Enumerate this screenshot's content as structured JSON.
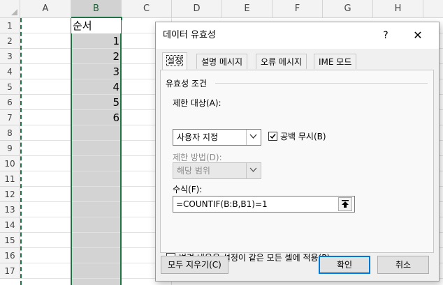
{
  "sheet": {
    "columns": [
      "A",
      "B",
      "C",
      "D",
      "E",
      "F",
      "G",
      "H"
    ],
    "rows": [
      "1",
      "2",
      "3",
      "4",
      "5",
      "6",
      "7",
      "8",
      "9",
      "10",
      "11",
      "12",
      "13",
      "14",
      "15",
      "16",
      "17"
    ],
    "b1": "순서",
    "b_values": [
      "1",
      "2",
      "3",
      "4",
      "5",
      "6"
    ],
    "selected_column": "B",
    "accent_color": "#217346"
  },
  "dialog": {
    "title": "데이터 유효성",
    "help": "?",
    "close": "✕",
    "tabs": [
      "설정",
      "설명 메시지",
      "오류 메시지",
      "IME 모드"
    ],
    "group_title": "유효성 조건",
    "allow_label": "제한 대상(A):",
    "allow_value": "사용자 지정",
    "ignore_blank_label": "공백 무시(B)",
    "ignore_blank_checked": true,
    "data_label": "제한 방법(D):",
    "data_value": "해당 범위",
    "formula_label": "수식(F):",
    "formula_value": "=COUNTIF(B:B,B1)=1",
    "apply_all_label": "변경 내용을 설정이 같은 모든 셀에 적용(P)",
    "apply_all_checked": false,
    "clear_all": "모두 지우기(C)",
    "ok": "확인",
    "cancel": "취소"
  }
}
